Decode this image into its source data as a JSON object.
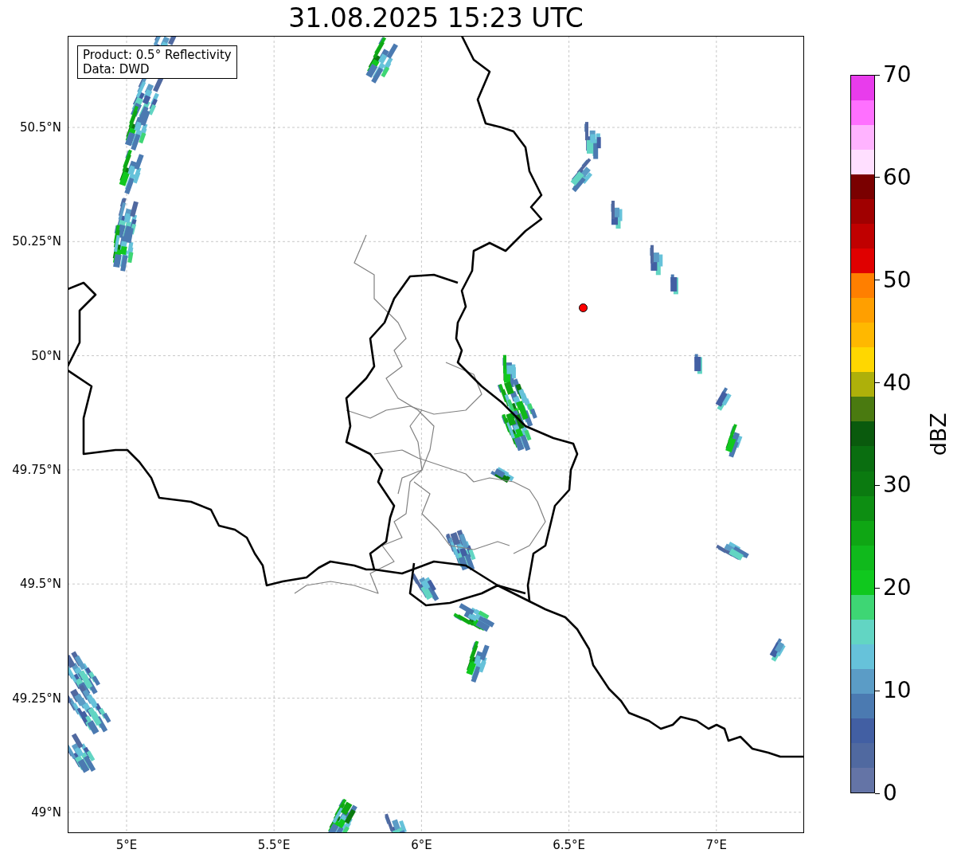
{
  "title": "31.08.2025 15:23 UTC",
  "info_box": [
    "Product: 0.5° Reflectivity",
    "Data: DWD"
  ],
  "map": {
    "lat_labels": [
      "50.5°N",
      "50.25°N",
      "50°N",
      "49.75°N",
      "49.5°N",
      "49.25°N",
      "49°N"
    ],
    "lon_labels": [
      "5°E",
      "5.5°E",
      "6°E",
      "6.5°E",
      "7°E"
    ]
  },
  "colorbar": {
    "label": "dBZ",
    "tick_labels": [
      "70",
      "60",
      "50",
      "40",
      "30",
      "20",
      "10",
      "0"
    ],
    "segments": [
      {
        "color": "#e83cec"
      },
      {
        "color": "#ff70ff"
      },
      {
        "color": "#ffb3ff"
      },
      {
        "color": "#ffdfff"
      },
      {
        "color": "#7a0000"
      },
      {
        "color": "#a00000"
      },
      {
        "color": "#c00000"
      },
      {
        "color": "#e00000"
      },
      {
        "color": "#ff7f00"
      },
      {
        "color": "#ff9f00"
      },
      {
        "color": "#ffb800"
      },
      {
        "color": "#ffd700"
      },
      {
        "color": "#aeb00a"
      },
      {
        "color": "#4a7a10"
      },
      {
        "color": "#0a5a0d"
      },
      {
        "color": "#0a6e10"
      },
      {
        "color": "#0b7a10"
      },
      {
        "color": "#0d8e12"
      },
      {
        "color": "#0fa614"
      },
      {
        "color": "#10b91c"
      },
      {
        "color": "#10c81e"
      },
      {
        "color": "#3ed674"
      },
      {
        "color": "#62d5c3"
      },
      {
        "color": "#66c2da"
      },
      {
        "color": "#5b9cc6"
      },
      {
        "color": "#4b7ab1"
      },
      {
        "color": "#425fa3"
      },
      {
        "color": "#5069a0"
      },
      {
        "color": "#6474a6"
      }
    ]
  }
}
